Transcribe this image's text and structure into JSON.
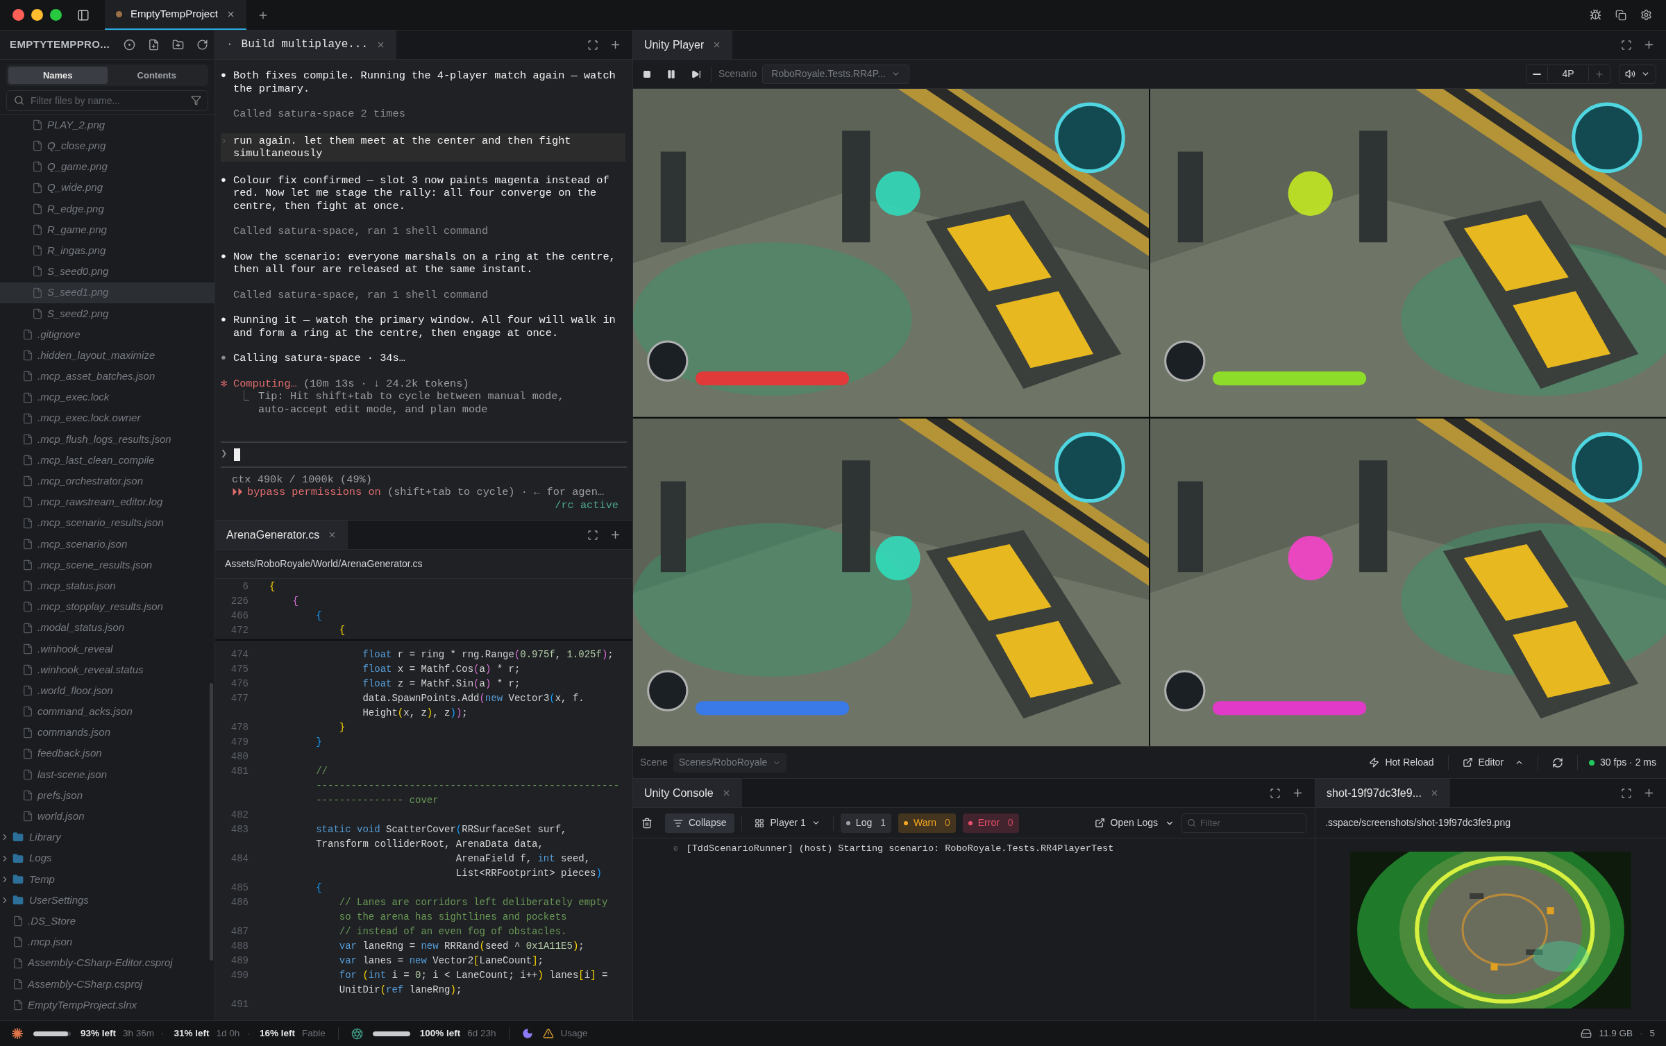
{
  "window": {
    "tab": "EmptyTempProject"
  },
  "sidebar": {
    "title": "EMPTYTEMPPRO...",
    "view_tabs": [
      {
        "label": "Names",
        "selected": true
      },
      {
        "label": "Contents",
        "selected": false
      }
    ],
    "search": {
      "placeholder": "Filter files by name..."
    },
    "tree": [
      {
        "children": [
          {
            "children": [
              {
                "label": "PLAY_2.png",
                "kind": "file",
                "selected": false
              },
              {
                "label": "Q_close.png",
                "kind": "file",
                "selected": false
              },
              {
                "label": "Q_game.png",
                "kind": "file",
                "selected": false
              },
              {
                "label": "Q_wide.png",
                "kind": "file",
                "selected": false
              },
              {
                "label": "R_edge.png",
                "kind": "file",
                "selected": false
              },
              {
                "label": "R_game.png",
                "kind": "file",
                "selected": false
              },
              {
                "label": "R_ingas.png",
                "kind": "file",
                "selected": false
              },
              {
                "label": "S_seed0.png",
                "kind": "file",
                "selected": false
              },
              {
                "label": "S_seed1.png",
                "kind": "file",
                "selected": true
              },
              {
                "label": "S_seed2.png",
                "kind": "file",
                "selected": false
              }
            ]
          },
          {
            "label": ".gitignore",
            "kind": "file",
            "selected": false
          },
          {
            "label": ".hidden_layout_maximize",
            "kind": "file",
            "selected": false
          },
          {
            "label": ".mcp_asset_batches.json",
            "kind": "file",
            "selected": false
          },
          {
            "label": ".mcp_exec.lock",
            "kind": "file",
            "selected": false
          },
          {
            "label": ".mcp_exec.lock.owner",
            "kind": "file",
            "selected": false
          },
          {
            "label": ".mcp_flush_logs_results.json",
            "kind": "file",
            "selected": false
          },
          {
            "label": ".mcp_last_clean_compile",
            "kind": "file",
            "selected": false
          },
          {
            "label": ".mcp_orchestrator.json",
            "kind": "file",
            "selected": false
          },
          {
            "label": ".mcp_rawstream_editor.log",
            "kind": "file",
            "selected": false
          },
          {
            "label": ".mcp_scenario_results.json",
            "kind": "file",
            "selected": false
          },
          {
            "label": ".mcp_scenario.json",
            "kind": "file",
            "selected": false
          },
          {
            "label": ".mcp_scene_results.json",
            "kind": "file",
            "selected": false
          },
          {
            "label": ".mcp_status.json",
            "kind": "file",
            "selected": false
          },
          {
            "label": ".mcp_stopplay_results.json",
            "kind": "file",
            "selected": false
          },
          {
            "label": ".modal_status.json",
            "kind": "file",
            "selected": false
          },
          {
            "label": ".winhook_reveal",
            "kind": "file",
            "selected": false
          },
          {
            "label": ".winhook_reveal.status",
            "kind": "file",
            "selected": false
          },
          {
            "label": ".world_floor.json",
            "kind": "file",
            "selected": false
          },
          {
            "label": "command_acks.json",
            "kind": "file",
            "selected": false
          },
          {
            "label": "commands.json",
            "kind": "file",
            "selected": false
          },
          {
            "label": "feedback.json",
            "kind": "file",
            "selected": false
          },
          {
            "label": "last-scene.json",
            "kind": "file",
            "selected": false
          },
          {
            "label": "prefs.json",
            "kind": "file",
            "selected": false
          },
          {
            "label": "world.json",
            "kind": "file",
            "selected": false
          }
        ]
      },
      {
        "label": "Library",
        "kind": "folder",
        "expanded": false,
        "selected": false
      },
      {
        "label": "Logs",
        "kind": "folder",
        "expanded": false,
        "selected": false
      },
      {
        "label": "Temp",
        "kind": "folder",
        "expanded": false,
        "selected": false
      },
      {
        "label": "UserSettings",
        "kind": "folder",
        "expanded": false,
        "selected": false
      },
      {
        "label": ".DS_Store",
        "kind": "file",
        "selected": false
      },
      {
        "label": ".mcp.json",
        "kind": "file",
        "selected": false
      },
      {
        "label": "Assembly-CSharp-Editor.csproj",
        "kind": "file",
        "selected": false
      },
      {
        "label": "Assembly-CSharp.csproj",
        "kind": "file",
        "selected": false
      },
      {
        "label": "EmptyTempProject.slnx",
        "kind": "file",
        "selected": false
      }
    ]
  },
  "chat": {
    "tab_marker": "·",
    "tab": "Build multiplaye...",
    "messages": [
      {
        "kind": "assistant",
        "bullet": "●",
        "text": "Both fixes compile. Running the 4-player match again — watch the primary."
      },
      {
        "kind": "tool",
        "text": "Called satura-space 2 times"
      },
      {
        "kind": "user",
        "marker": "›",
        "text": "run again. let them meet at the center and then fight simultaneously"
      },
      {
        "kind": "assistant",
        "bullet": "●",
        "text": "Colour fix confirmed — slot 3 now paints magenta instead of red. Now let me stage the rally: all four converge on the centre, then fight at once."
      },
      {
        "kind": "tool",
        "text": "Called satura-space, ran 1 shell command"
      },
      {
        "kind": "assistant",
        "bullet": "●",
        "text": "Now the scenario: everyone marshals on a ring at the centre, then all four are released at the same instant."
      },
      {
        "kind": "tool",
        "text": "Called satura-space, ran 1 shell command"
      },
      {
        "kind": "assistant",
        "bullet": "●",
        "text": "Running it — watch the primary window. All four will walk in and form a ring at the centre, then engage at once."
      },
      {
        "kind": "pending",
        "bullet": "●",
        "text": "Calling satura-space · 34s…"
      },
      {
        "kind": "status",
        "bullet": "✻",
        "label": "Computing…",
        "detail": " (10m 13s · ↓ 24.2k tokens)",
        "tip_marker": "⎿",
        "tip": "Tip: Hit shift+tab to cycle between manual mode, auto-accept edit mode, and plan mode"
      }
    ],
    "prompt": "❯",
    "context": "ctx 490k / 1000k (49%)",
    "mode_icon": "⏵⏵",
    "mode": "bypass permissions on",
    "mode_hint": " (shift+tab to cycle) · ← for agen…",
    "remote": "/rc active"
  },
  "editor": {
    "tab": "ArenaGenerator.cs",
    "path": "Assets/RoboRoyale/World/ArenaGenerator.cs",
    "sticky": [
      {
        "number": "6",
        "tokens": [
          {
            "kind": "yellow",
            "text": "{"
          }
        ]
      },
      {
        "number": "226",
        "tokens": [
          {
            "kind": "magenta",
            "text": "    {"
          }
        ]
      },
      {
        "number": "466",
        "tokens": [
          {
            "kind": "blue",
            "text": "        {"
          }
        ]
      },
      {
        "number": "472",
        "tokens": [
          {
            "kind": "yellow",
            "text": "            {"
          }
        ]
      }
    ],
    "rows": [
      {
        "number": "474",
        "tokens": [
          {
            "kind": "keyword",
            "text": "                float"
          },
          {
            "kind": "plain",
            "text": " r = ring * rng.Range"
          },
          {
            "kind": "magenta",
            "text": "("
          },
          {
            "kind": "number",
            "text": "0.975f"
          },
          {
            "kind": "plain",
            "text": ", "
          },
          {
            "kind": "number",
            "text": "1.025f"
          },
          {
            "kind": "magenta",
            "text": ")"
          },
          {
            "kind": "plain",
            "text": ";"
          }
        ]
      },
      {
        "number": "475",
        "tokens": [
          {
            "kind": "keyword",
            "text": "                float"
          },
          {
            "kind": "plain",
            "text": " x = Mathf.Cos"
          },
          {
            "kind": "magenta",
            "text": "("
          },
          {
            "kind": "plain",
            "text": "a"
          },
          {
            "kind": "magenta",
            "text": ")"
          },
          {
            "kind": "plain",
            "text": " * r;"
          }
        ]
      },
      {
        "number": "476",
        "tokens": [
          {
            "kind": "keyword",
            "text": "                float"
          },
          {
            "kind": "plain",
            "text": " z = Mathf.Sin"
          },
          {
            "kind": "magenta",
            "text": "("
          },
          {
            "kind": "plain",
            "text": "a"
          },
          {
            "kind": "magenta",
            "text": ")"
          },
          {
            "kind": "plain",
            "text": " * r;"
          }
        ]
      },
      {
        "number": "477",
        "tokens": [
          {
            "kind": "plain",
            "text": "                data.SpawnPoints.Add"
          },
          {
            "kind": "magenta",
            "text": "("
          },
          {
            "kind": "keyword",
            "text": "new"
          },
          {
            "kind": "plain",
            "text": " Vector3"
          },
          {
            "kind": "blue",
            "text": "("
          },
          {
            "kind": "plain",
            "text": "x, f."
          }
        ]
      },
      {
        "tokens": [
          {
            "kind": "plain",
            "text": "                Height"
          },
          {
            "kind": "yellow",
            "text": "("
          },
          {
            "kind": "plain",
            "text": "x, z"
          },
          {
            "kind": "yellow",
            "text": ")"
          },
          {
            "kind": "plain",
            "text": ", z"
          },
          {
            "kind": "blue",
            "text": ")"
          },
          {
            "kind": "magenta",
            "text": ")"
          },
          {
            "kind": "plain",
            "text": ";"
          }
        ]
      },
      {
        "number": "478",
        "tokens": [
          {
            "kind": "yellow",
            "text": "            }"
          }
        ]
      },
      {
        "number": "479",
        "tokens": [
          {
            "kind": "blue",
            "text": "        }"
          }
        ]
      },
      {
        "number": "480"
      },
      {
        "number": "481",
        "tokens": [
          {
            "kind": "comment",
            "text": "        //"
          }
        ]
      },
      {
        "tokens": [
          {
            "kind": "comment",
            "text": "        ----------------------------------------------------"
          }
        ]
      },
      {
        "tokens": [
          {
            "kind": "comment",
            "text": "        --------------- cover"
          }
        ]
      },
      {
        "number": "482"
      },
      {
        "number": "483",
        "tokens": [
          {
            "kind": "keyword",
            "text": "        static void"
          },
          {
            "kind": "plain",
            "text": " ScatterCover"
          },
          {
            "kind": "blue",
            "text": "("
          },
          {
            "kind": "plain",
            "text": "RRSurfaceSet surf,"
          }
        ]
      },
      {
        "tokens": [
          {
            "kind": "plain",
            "text": "        Transform colliderRoot, ArenaData data,"
          }
        ]
      },
      {
        "number": "484",
        "tokens": [
          {
            "kind": "plain",
            "text": "                                ArenaField f, "
          },
          {
            "kind": "keyword",
            "text": "int"
          },
          {
            "kind": "plain",
            "text": " seed,"
          }
        ]
      },
      {
        "tokens": [
          {
            "kind": "plain",
            "text": "                                List<RRFootprint> pieces"
          },
          {
            "kind": "blue",
            "text": ")"
          }
        ]
      },
      {
        "number": "485",
        "tokens": [
          {
            "kind": "blue",
            "text": "        {"
          }
        ]
      },
      {
        "number": "486",
        "tokens": [
          {
            "kind": "comment",
            "text": "            // Lanes are corridors left deliberately empty"
          }
        ]
      },
      {
        "tokens": [
          {
            "kind": "comment",
            "text": "            so the arena has sightlines and pockets"
          }
        ]
      },
      {
        "number": "487",
        "tokens": [
          {
            "kind": "comment",
            "text": "            // instead of an even fog of obstacles."
          }
        ]
      },
      {
        "number": "488",
        "tokens": [
          {
            "kind": "keyword",
            "text": "            var"
          },
          {
            "kind": "plain",
            "text": " laneRng = "
          },
          {
            "kind": "keyword",
            "text": "new"
          },
          {
            "kind": "plain",
            "text": " RRRand"
          },
          {
            "kind": "yellow",
            "text": "("
          },
          {
            "kind": "plain",
            "text": "seed ^ "
          },
          {
            "kind": "number",
            "text": "0x1A11E5"
          },
          {
            "kind": "yellow",
            "text": ")"
          },
          {
            "kind": "plain",
            "text": ";"
          }
        ]
      },
      {
        "number": "489",
        "tokens": [
          {
            "kind": "keyword",
            "text": "            var"
          },
          {
            "kind": "plain",
            "text": " lanes = "
          },
          {
            "kind": "keyword",
            "text": "new"
          },
          {
            "kind": "plain",
            "text": " Vector2"
          },
          {
            "kind": "yellow",
            "text": "["
          },
          {
            "kind": "plain",
            "text": "LaneCount"
          },
          {
            "kind": "yellow",
            "text": "]"
          },
          {
            "kind": "plain",
            "text": ";"
          }
        ]
      },
      {
        "number": "490",
        "tokens": [
          {
            "kind": "keyword",
            "text": "            for"
          },
          {
            "kind": "yellow",
            "text": " ("
          },
          {
            "kind": "keyword",
            "text": "int"
          },
          {
            "kind": "plain",
            "text": " i = "
          },
          {
            "kind": "number",
            "text": "0"
          },
          {
            "kind": "plain",
            "text": "; i < LaneCount; i++"
          },
          {
            "kind": "yellow",
            "text": ")"
          },
          {
            "kind": "plain",
            "text": " lanes"
          },
          {
            "kind": "yellow",
            "text": "["
          },
          {
            "kind": "plain",
            "text": "i"
          },
          {
            "kind": "yellow",
            "text": "]"
          },
          {
            "kind": "plain",
            "text": " ="
          }
        ]
      },
      {
        "tokens": [
          {
            "kind": "plain",
            "text": "            UnitDir"
          },
          {
            "kind": "yellow",
            "text": "("
          },
          {
            "kind": "keyword",
            "text": "ref"
          },
          {
            "kind": "plain",
            "text": " laneRng"
          },
          {
            "kind": "yellow",
            "text": ")"
          },
          {
            "kind": "plain",
            "text": ";"
          }
        ]
      },
      {
        "number": "491"
      }
    ]
  },
  "player": {
    "tab": "Unity Player",
    "scenario_label": "Scenario",
    "scenario": "RoboRoyale.Tests.RR4P...",
    "players": "4P"
  },
  "scene_bar": {
    "label": "Scene",
    "scene": "Scenes/RoboRoyale",
    "hot_reload": "Hot Reload",
    "editor": "Editor",
    "fps": "30 fps · 2 ms"
  },
  "console": {
    "tab": "Unity Console",
    "collapse": {
      "label": "Collapse",
      "on": true
    },
    "player": "Player 1",
    "filters": [
      {
        "label": "Log",
        "count": "1",
        "color": "#9ca3af"
      },
      {
        "label": "Warn",
        "count": "0",
        "color": "#f5a623"
      },
      {
        "label": "Error",
        "count": "0",
        "color": "#f0506e"
      }
    ],
    "open_logs": "Open Logs",
    "filter": {
      "placeholder": "Filter"
    },
    "entries": [
      {
        "index": "0",
        "message": "[TddScenarioRunner] (host) Starting scenario: RoboRoyale.Tests.RR4PlayerTest"
      }
    ]
  },
  "preview": {
    "tab": "shot-19f97dc3fe9...",
    "path": ".sspace/screenshots/shot-19f97dc3fe9.png"
  },
  "status_bar": {
    "separator": "·",
    "providers": [
      {
        "kind": "spark",
        "level": 0.93,
        "limits": [
          {
            "left": "93% left",
            "reset": "3h 36m"
          },
          {
            "left": "31% left",
            "reset": "1d 0h"
          },
          {
            "left": "16% left",
            "reset": "Fable"
          }
        ]
      },
      {
        "kind": "aperture",
        "level": 1,
        "limits": [
          {
            "left": "100% left",
            "reset": "6d 23h"
          }
        ]
      }
    ],
    "usage": "Usage",
    "memory": "11.9 GB",
    "count": "5"
  }
}
